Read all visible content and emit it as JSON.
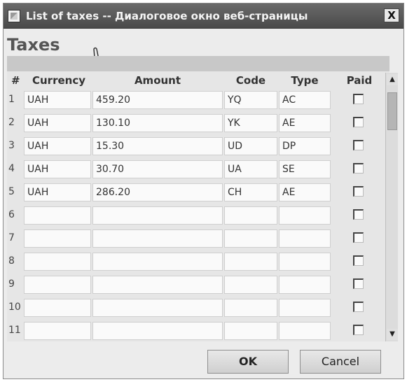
{
  "window": {
    "title": "List of taxes -- Диалоговое окно веб-страницы",
    "close_label": "X"
  },
  "heading": "Taxes",
  "table": {
    "columns": [
      "#",
      "Currency",
      "Amount",
      "Code",
      "Type",
      "Paid"
    ],
    "rows": [
      {
        "num": "1",
        "currency": "UAH",
        "amount": "459.20",
        "code": "YQ",
        "type": "AC",
        "paid": false
      },
      {
        "num": "2",
        "currency": "UAH",
        "amount": "130.10",
        "code": "YK",
        "type": "AE",
        "paid": false
      },
      {
        "num": "3",
        "currency": "UAH",
        "amount": "15.30",
        "code": "UD",
        "type": "DP",
        "paid": false
      },
      {
        "num": "4",
        "currency": "UAH",
        "amount": "30.70",
        "code": "UA",
        "type": "SE",
        "paid": false
      },
      {
        "num": "5",
        "currency": "UAH",
        "amount": "286.20",
        "code": "CH",
        "type": "AE",
        "paid": false
      },
      {
        "num": "6",
        "currency": "",
        "amount": "",
        "code": "",
        "type": "",
        "paid": false
      },
      {
        "num": "7",
        "currency": "",
        "amount": "",
        "code": "",
        "type": "",
        "paid": false
      },
      {
        "num": "8",
        "currency": "",
        "amount": "",
        "code": "",
        "type": "",
        "paid": false
      },
      {
        "num": "9",
        "currency": "",
        "amount": "",
        "code": "",
        "type": "",
        "paid": false
      },
      {
        "num": "10",
        "currency": "",
        "amount": "",
        "code": "",
        "type": "",
        "paid": false
      },
      {
        "num": "11",
        "currency": "",
        "amount": "",
        "code": "",
        "type": "",
        "paid": false
      }
    ]
  },
  "buttons": {
    "ok_label": "OK",
    "cancel_label": "Cancel"
  },
  "icons": {
    "window_icon": "page-icon",
    "hand": "hand-pointer-icon",
    "scroll_up": "scroll-up-arrow-icon",
    "scroll_down": "scroll-down-arrow-icon"
  }
}
